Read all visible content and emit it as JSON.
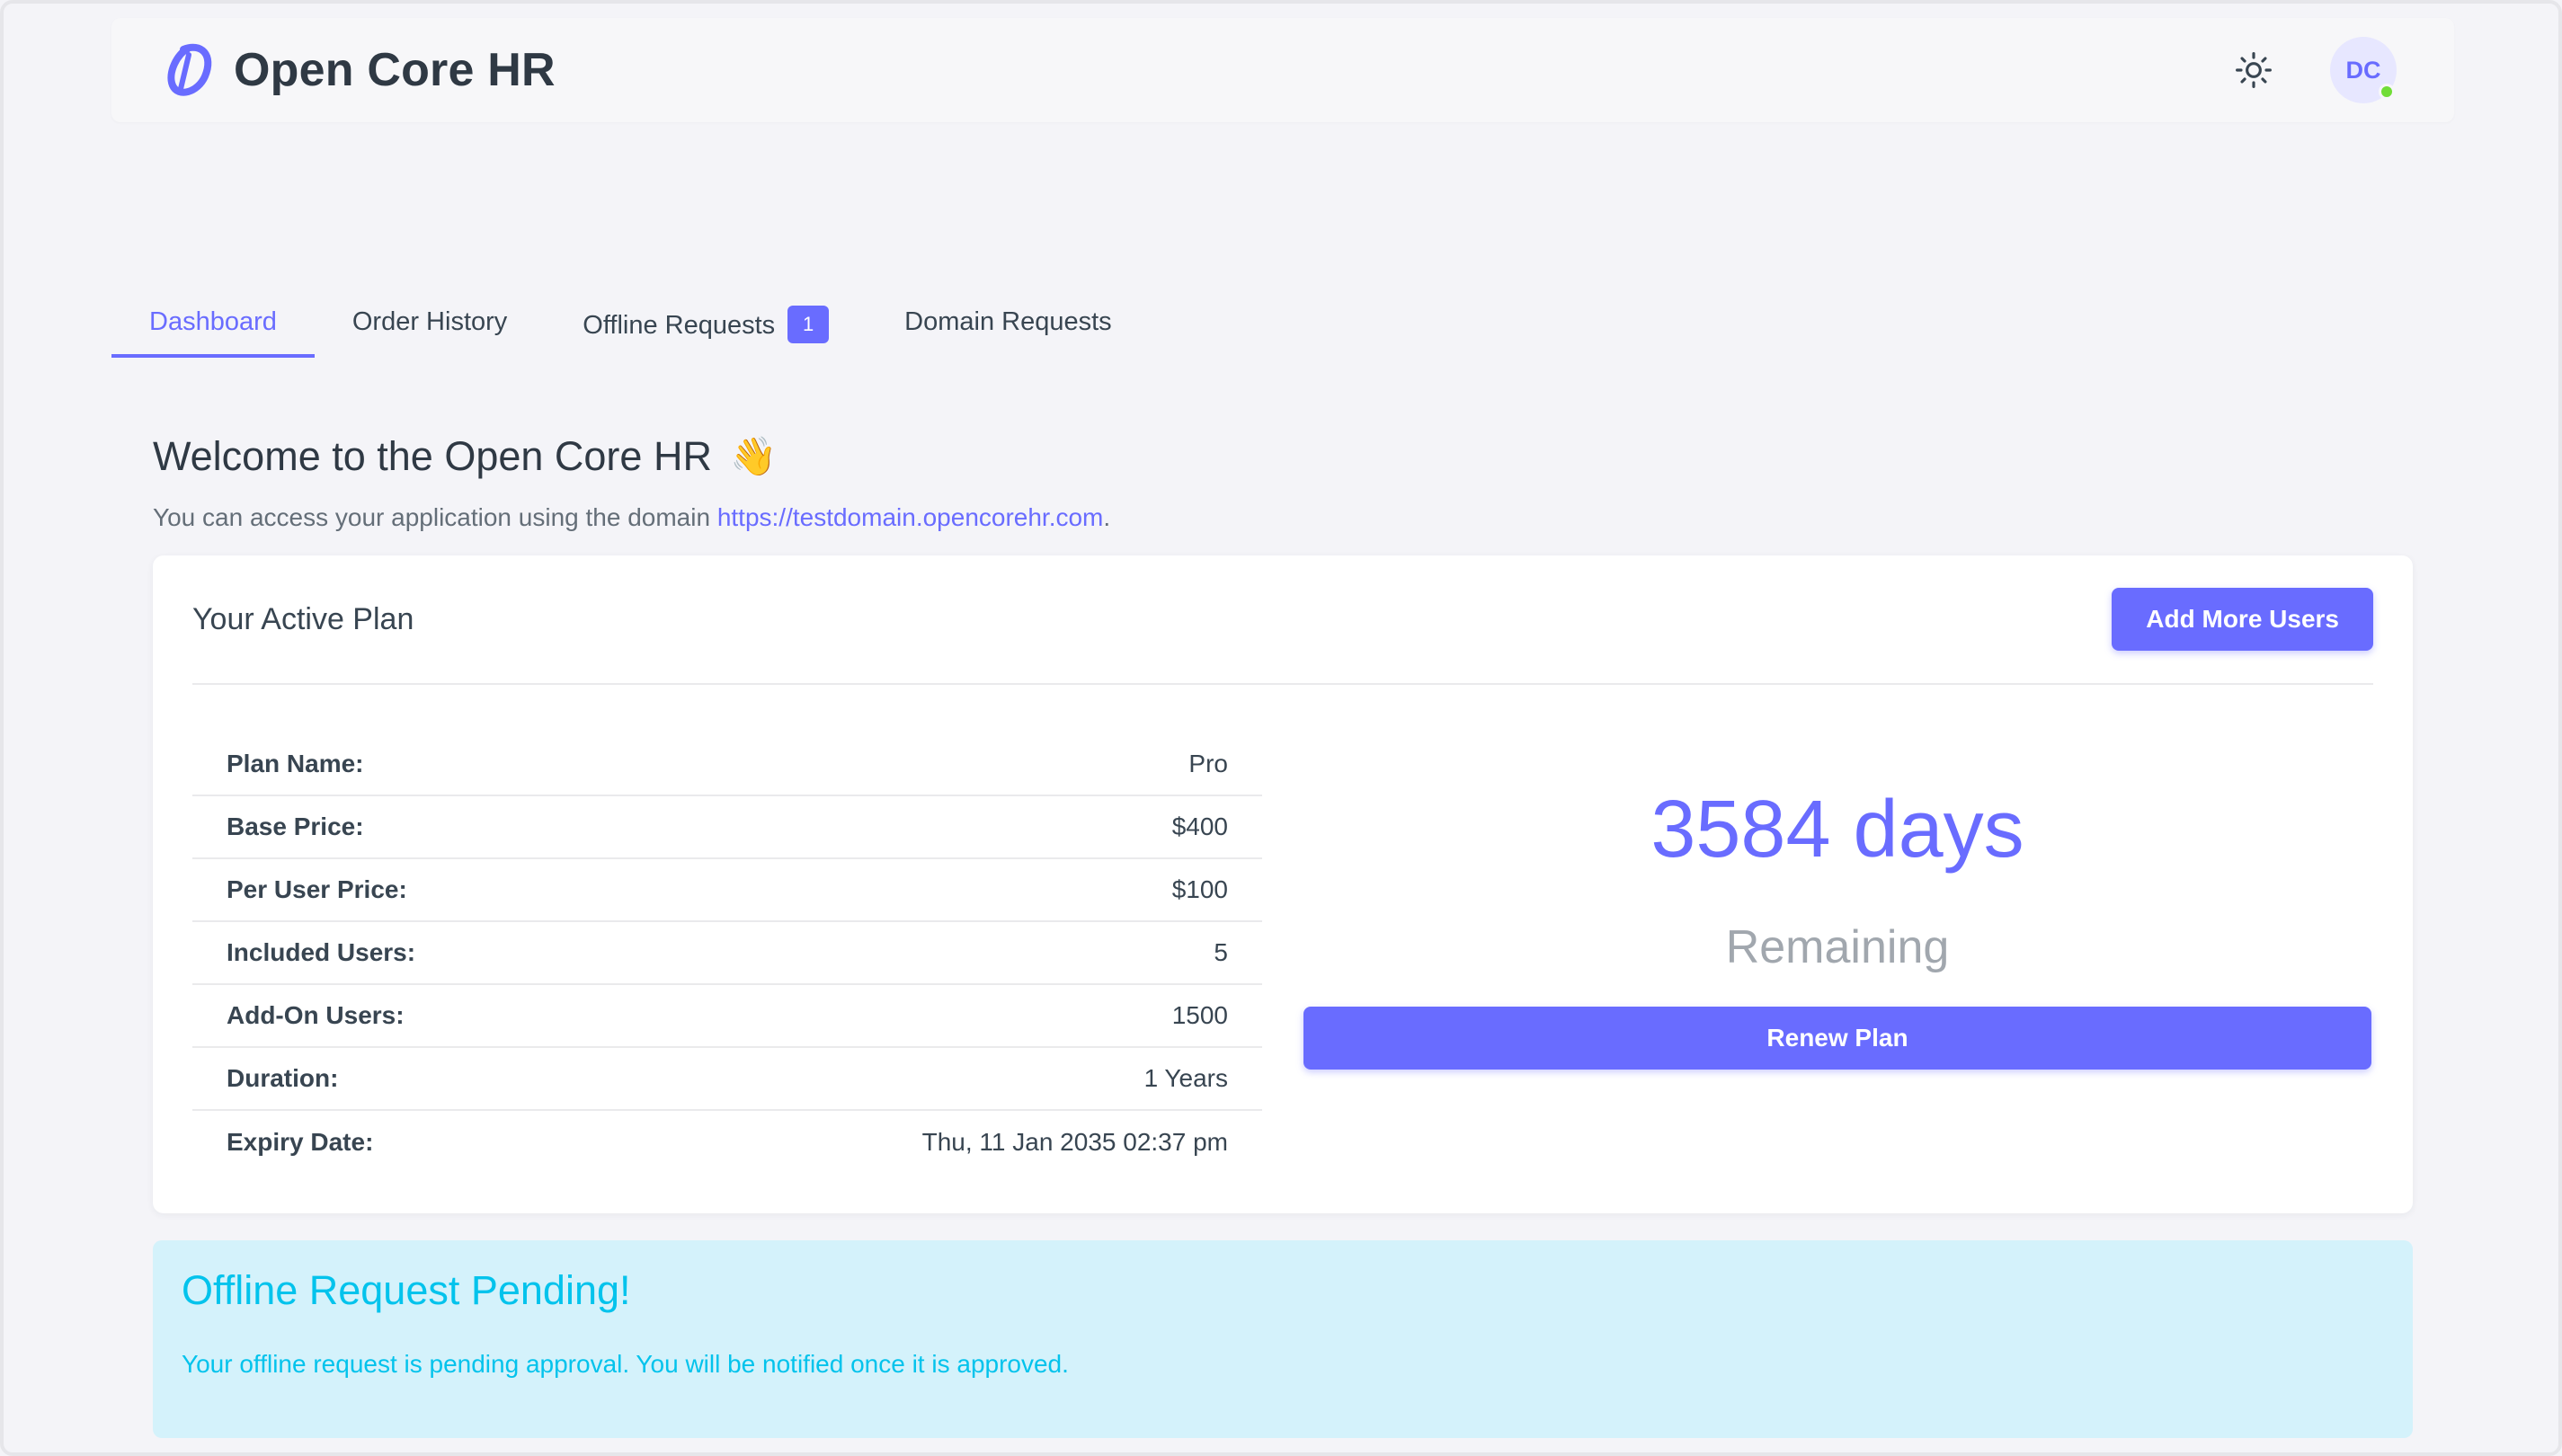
{
  "app": {
    "name": "Open Core HR",
    "accent": "#696cff"
  },
  "navbar": {
    "theme_icon": "sun-icon",
    "avatar_initials": "DC",
    "status": "online"
  },
  "tabs": [
    {
      "label": "Dashboard",
      "active": true
    },
    {
      "label": "Order History",
      "active": false
    },
    {
      "label": "Offline Requests",
      "badge": "1",
      "active": false
    },
    {
      "label": "Domain Requests",
      "active": false
    }
  ],
  "welcome": {
    "title": "Welcome to the Open Core HR",
    "emoji": "👋",
    "subtitle_prefix": "You can access your application using the domain ",
    "domain_link": "https://testdomain.opencorehr.com",
    "subtitle_suffix": "."
  },
  "plan_card": {
    "title": "Your Active Plan",
    "add_users_label": "Add More Users",
    "rows": [
      {
        "label": "Plan Name:",
        "value": "Pro"
      },
      {
        "label": "Base Price:",
        "value": "$400"
      },
      {
        "label": "Per User Price:",
        "value": "$100"
      },
      {
        "label": "Included Users:",
        "value": "5"
      },
      {
        "label": "Add-On Users:",
        "value": "1500"
      },
      {
        "label": "Duration:",
        "value": "1 Years"
      },
      {
        "label": "Expiry Date:",
        "value": "Thu, 11 Jan 2035 02:37 pm"
      }
    ],
    "days_remaining": "3584 days",
    "remaining_label": "Remaining",
    "renew_label": "Renew Plan"
  },
  "alert": {
    "title": "Offline Request Pending!",
    "text": "Your offline request is pending approval. You will be notified once it is approved.",
    "color": "#03c3ec",
    "background": "#d4f2fb"
  }
}
